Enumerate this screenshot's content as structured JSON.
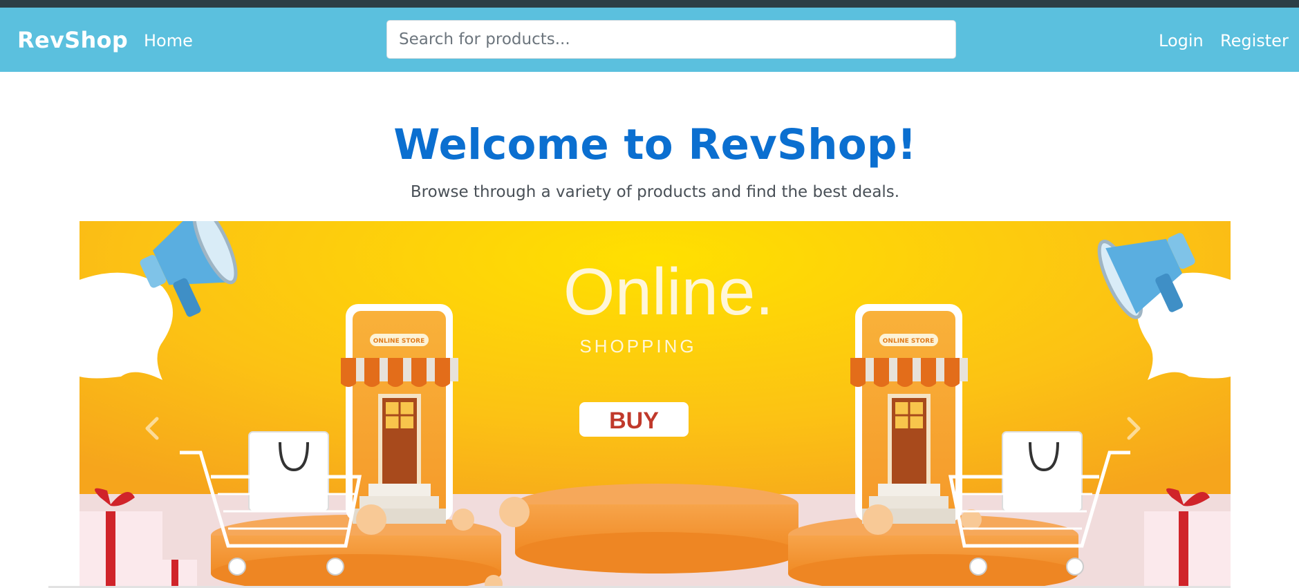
{
  "topbar": {
    "brand": "RevShop",
    "nav_home": "Home",
    "search_placeholder": "Search for products...",
    "login": "Login",
    "register": "Register"
  },
  "hero": {
    "title": "Welcome to RevShop!",
    "subtitle": "Browse through a variety of products and find the best deals."
  },
  "banner": {
    "headline": "Online.",
    "subheadline": "SHOPPING",
    "buy_label": "BUY",
    "store_sign": "ONLINE STORE"
  },
  "carousel": {
    "prev_icon": "chevron-left-icon",
    "next_icon": "chevron-right-icon"
  },
  "colors": {
    "navbar": "#5bc0de",
    "title": "#0b6fd0",
    "banner_yellow": "#fcc214",
    "banner_orange": "#f7941d"
  }
}
